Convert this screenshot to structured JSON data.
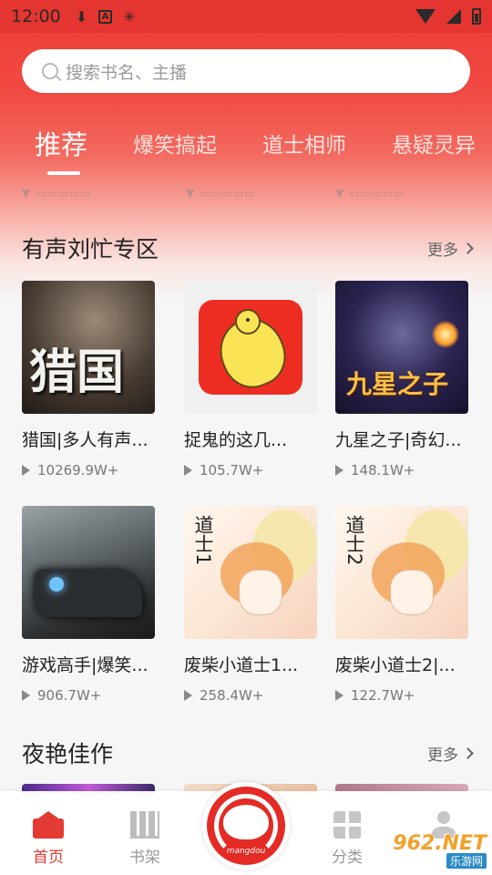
{
  "status_bar": {
    "time": "12:00",
    "icons": [
      "download-icon",
      "a-badge-icon",
      "bug-icon",
      "wifi-icon",
      "signal-icon",
      "battery-icon"
    ]
  },
  "search": {
    "placeholder": "搜索书名、主播"
  },
  "tabs": [
    {
      "label": "推荐",
      "active": true
    },
    {
      "label": "爆笑搞起",
      "active": false
    },
    {
      "label": "道士相师",
      "active": false
    },
    {
      "label": "悬疑灵异",
      "active": false
    }
  ],
  "sections": [
    {
      "title": "有声刘忙专区",
      "more": "更多",
      "items": [
        {
          "title": "猎国|多人有声...",
          "plays": "10269.9W+",
          "cover_text": "猎国"
        },
        {
          "title": "捉鬼的这几...",
          "plays": "105.7W+"
        },
        {
          "title": "九星之子|奇幻...",
          "plays": "148.1W+",
          "cover_text": "九星之子"
        },
        {
          "title": "游戏高手|爆笑...",
          "plays": "906.7W+"
        },
        {
          "title": "废柴小道士1...",
          "plays": "258.4W+",
          "cover_text": "道士1"
        },
        {
          "title": "废柴小道士2|...",
          "plays": "122.7W+",
          "cover_text": "道士2"
        }
      ]
    },
    {
      "title": "夜艳佳作",
      "more": "更多"
    }
  ],
  "tabbar": {
    "home": "首页",
    "shelf": "书架",
    "category": "分类",
    "center_brand": "mangdou"
  },
  "watermark": {
    "line1": "962.NET",
    "line2": "乐游网"
  },
  "colors": {
    "accent": "#e33a33",
    "header": "#ee3b35"
  }
}
